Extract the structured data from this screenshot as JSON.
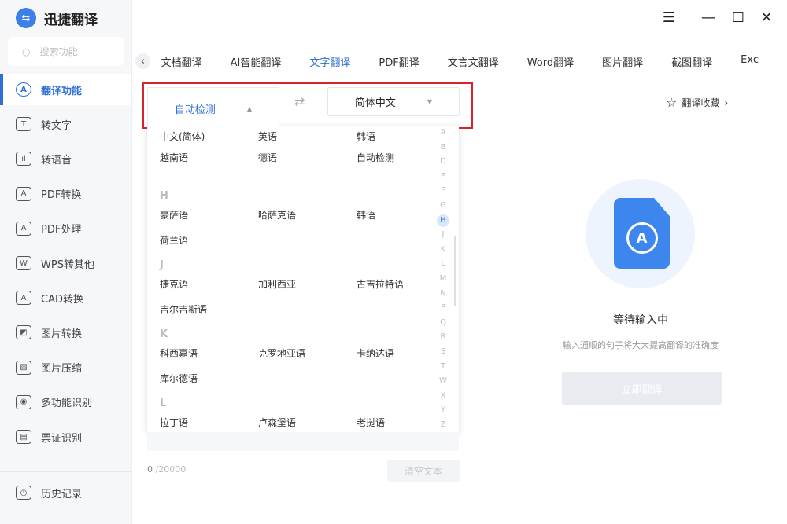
{
  "app": {
    "title": "迅捷翻译",
    "search_placeholder": "搜索功能"
  },
  "sidebar": {
    "items": [
      {
        "label": "翻译功能",
        "icon": "translate-icon",
        "active": true
      },
      {
        "label": "转文字",
        "icon": "text-convert-icon"
      },
      {
        "label": "转语音",
        "icon": "voice-icon"
      },
      {
        "label": "PDF转换",
        "icon": "pdf-convert-icon"
      },
      {
        "label": "PDF处理",
        "icon": "pdf-process-icon"
      },
      {
        "label": "WPS转其他",
        "icon": "wps-icon"
      },
      {
        "label": "CAD转换",
        "icon": "cad-icon"
      },
      {
        "label": "图片转换",
        "icon": "image-convert-icon"
      },
      {
        "label": "图片压缩",
        "icon": "image-compress-icon"
      },
      {
        "label": "多功能识别",
        "icon": "eye-scan-icon"
      },
      {
        "label": "票证识别",
        "icon": "ticket-scan-icon"
      }
    ],
    "history": "历史记录"
  },
  "window": {
    "menu": "☰",
    "minimize": "—",
    "maximize": "☐",
    "close": "✕"
  },
  "tabs": [
    "文档翻译",
    "AI智能翻译",
    "文字翻译",
    "PDF翻译",
    "文言文翻译",
    "Word翻译",
    "图片翻译",
    "截图翻译",
    "Exc"
  ],
  "lang": {
    "source": "自动检测",
    "target": "简体中文",
    "source_caret": "▲",
    "target_caret": "▼",
    "swap": "⇄"
  },
  "dropdown": {
    "common": [
      [
        "中文(简体)",
        "英语",
        "韩语"
      ],
      [
        "越南语",
        "德语",
        "自动检测"
      ]
    ],
    "groups": [
      {
        "letter": "H",
        "rows": [
          [
            "豪萨语",
            "哈萨克语",
            "韩语"
          ],
          [
            "荷兰语"
          ]
        ]
      },
      {
        "letter": "J",
        "rows": [
          [
            "捷克语",
            "加利西亚",
            "古吉拉特语"
          ],
          [
            "吉尔吉斯语"
          ]
        ]
      },
      {
        "letter": "K",
        "rows": [
          [
            "科西嘉语",
            "克罗地亚语",
            "卡纳达语"
          ],
          [
            "库尔德语"
          ]
        ]
      },
      {
        "letter": "L",
        "rows": [
          [
            "拉丁语",
            "卢森堡语",
            "老挝语"
          ]
        ]
      }
    ],
    "index": [
      "A",
      "B",
      "D",
      "E",
      "F",
      "G",
      "H",
      "J",
      "K",
      "L",
      "M",
      "N",
      "P",
      "Q",
      "R",
      "S",
      "T",
      "W",
      "X",
      "Y",
      "Z"
    ],
    "active_index": "H"
  },
  "input": {
    "count": "0",
    "max": "/20000",
    "clear": "清空文本"
  },
  "favorites": "翻译收藏",
  "result": {
    "title": "等待输入中",
    "hint": "输入通顺的句子将大大提高翻译的准确度",
    "button": "立即翻译"
  },
  "colors": {
    "accent": "#2f6fd6",
    "highlight_box": "#d9232b"
  }
}
